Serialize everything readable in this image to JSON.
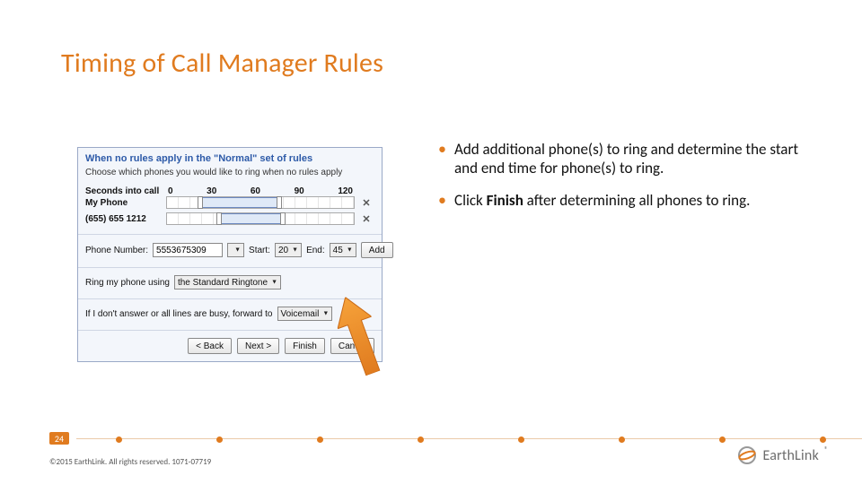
{
  "title": "Timing of Call Manager Rules",
  "bullets": [
    {
      "parts": [
        {
          "bold": false,
          "text": "Add additional phone(s) to ring and determine the start and end time for phone(s) to ring."
        }
      ]
    },
    {
      "parts": [
        {
          "bold": false,
          "text": "Click "
        },
        {
          "bold": true,
          "text": "Finish"
        },
        {
          "bold": false,
          "text": " after determining all phones to ring."
        }
      ]
    }
  ],
  "panel": {
    "header": "When no rules apply in the \"Normal\" set of rules",
    "sub": "Choose which phones you would like to ring when no rules apply",
    "ticks": [
      "0",
      "30",
      "60",
      "90",
      "120"
    ],
    "seconds_label": "Seconds into call",
    "rows": [
      {
        "label": "My Phone",
        "range_pct": [
          18,
          60
        ]
      },
      {
        "label": "(655) 655 1212",
        "range_pct": [
          28,
          62
        ]
      }
    ],
    "phone_label": "Phone Number:",
    "phone_value": "5553675309",
    "start_label": "Start:",
    "start_value": "20",
    "end_label": "End:",
    "end_value": "45",
    "add_label": "Add",
    "ringtone_label": "Ring my phone using",
    "ringtone_value": "the Standard Ringtone",
    "forward_label": "If I don't answer or all lines are busy, forward to",
    "forward_value": "Voicemail",
    "buttons": {
      "back": "< Back",
      "next": "Next >",
      "finish": "Finish",
      "cancel": "Cancel"
    }
  },
  "footer": {
    "page": "24",
    "copyright": "©2015 EarthLink. All rights reserved. 1071-07719",
    "logo_text": "EarthLink",
    "logo_reg": "®"
  }
}
